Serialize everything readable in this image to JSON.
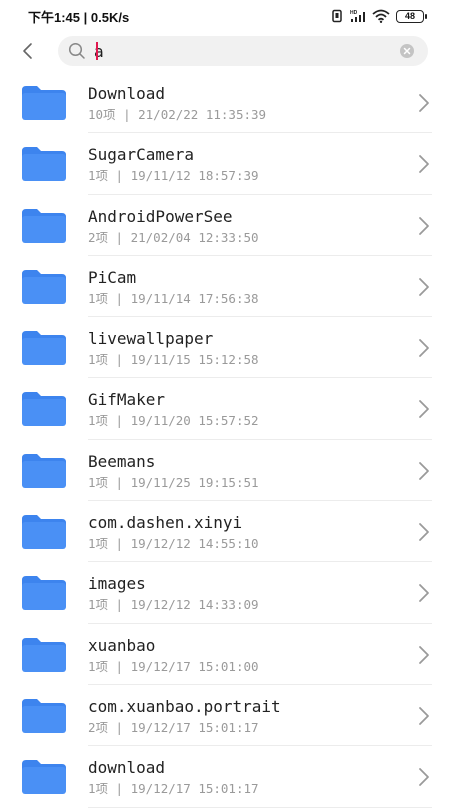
{
  "status_bar": {
    "time_speed": "下午1:45 | 0.5K/s",
    "battery": "48"
  },
  "search": {
    "value": "a",
    "back_icon": "chevron-left-icon",
    "search_icon": "search-icon",
    "clear_icon": "clear-icon"
  },
  "colors": {
    "folder": "#4a90f5",
    "folder_tab": "#3d84ee",
    "caret": "#e0184f"
  },
  "items": [
    {
      "name": "Download",
      "meta": "10项 | 21/02/22 11:35:39"
    },
    {
      "name": "SugarCamera",
      "meta": "1项 | 19/11/12 18:57:39"
    },
    {
      "name": "AndroidPowerSee",
      "meta": "2项 | 21/02/04 12:33:50"
    },
    {
      "name": "PiCam",
      "meta": "1项 | 19/11/14 17:56:38"
    },
    {
      "name": "livewallpaper",
      "meta": "1项 | 19/11/15 15:12:58"
    },
    {
      "name": "GifMaker",
      "meta": "1项 | 19/11/20 15:57:52"
    },
    {
      "name": "Beemans",
      "meta": "1项 | 19/11/25 19:15:51"
    },
    {
      "name": "com.dashen.xinyi",
      "meta": "1项 | 19/12/12 14:55:10"
    },
    {
      "name": "images",
      "meta": "1项 | 19/12/12 14:33:09"
    },
    {
      "name": "xuanbao",
      "meta": "1项 | 19/12/17 15:01:00"
    },
    {
      "name": "com.xuanbao.portrait",
      "meta": "2项 | 19/12/17 15:01:17"
    },
    {
      "name": "download",
      "meta": "1项 | 19/12/17 15:01:17"
    }
  ]
}
